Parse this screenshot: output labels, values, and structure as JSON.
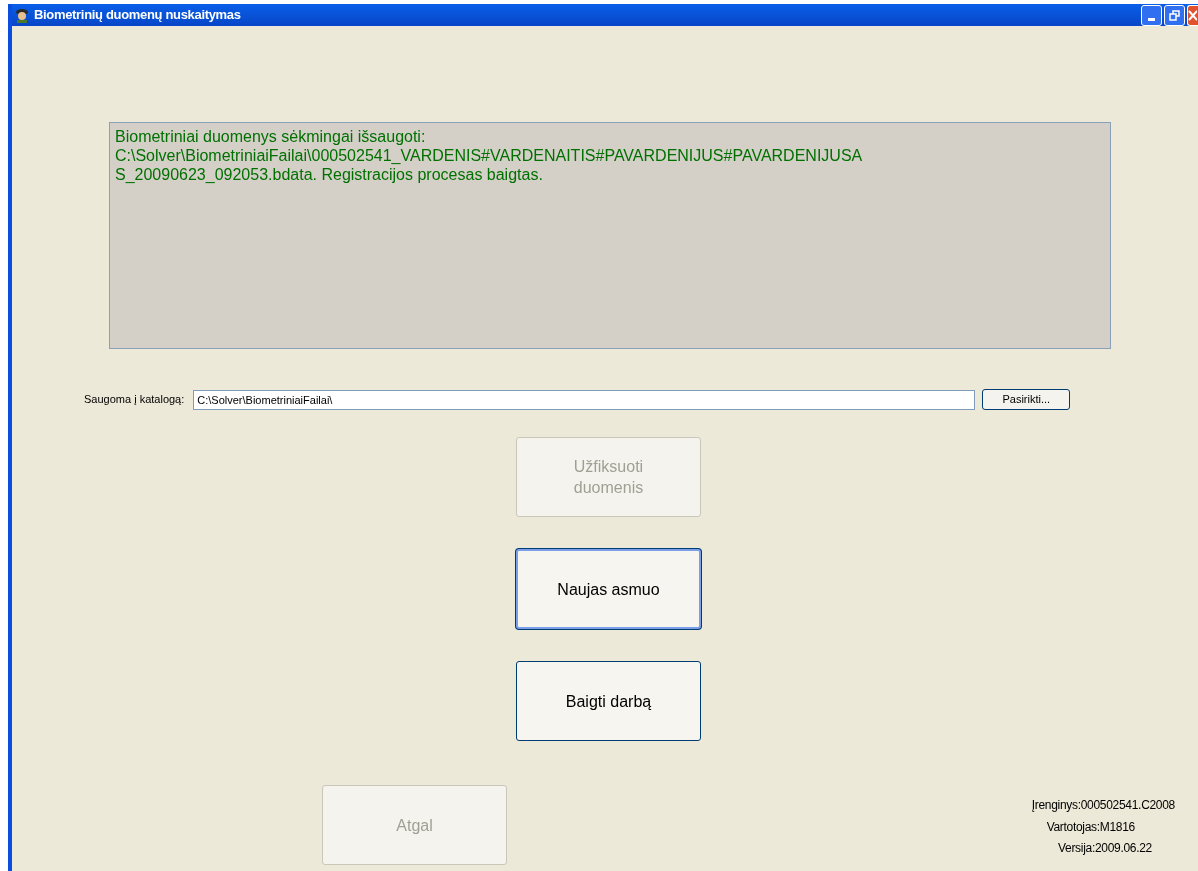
{
  "window": {
    "title": "Biometrinių duomenų nuskaitymas"
  },
  "message": {
    "lines": [
      "Biometriniai duomenys sėkmingai išsaugoti:",
      "C:\\Solver\\BiometriniaiFailai\\000502541_VARDENIS#VARDENAITIS#PAVARDENIJUS#PAVARDENIJUSA",
      "S_20090623_092053.bdata. Registracijos procesas baigtas."
    ]
  },
  "folder": {
    "label": "Saugoma į katalogą:",
    "value": "C:\\Solver\\BiometriniaiFailai\\",
    "browse_button": "Pasirikti..."
  },
  "buttons": [
    {
      "label": "Užfiksuoti duomenis",
      "disabled": true,
      "focused": false
    },
    {
      "label": "Naujas asmuo",
      "disabled": false,
      "focused": true
    },
    {
      "label": "Baigti darbą",
      "disabled": false,
      "focused": false
    }
  ],
  "back_button": {
    "label": "Atgal",
    "disabled": true
  },
  "status": [
    "Įrenginys:000502541.C2008",
    "Vartotojas:M1816",
    "Versija:2009.06.22"
  ]
}
